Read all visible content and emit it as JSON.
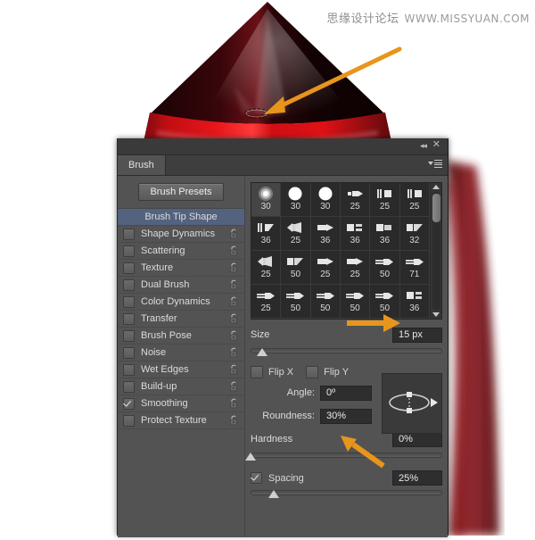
{
  "watermark": {
    "cn": "思缘设计论坛",
    "en": "WWW.MISSYUAN.COM"
  },
  "artwork": {
    "description": "red rocket nose cone with dark tip",
    "body_red": "#d60d11",
    "tip_dark": "#1b0405",
    "side_red": "#7d1a20",
    "annotation_color": "#e8951b",
    "selection_label": "elliptical marquee selection"
  },
  "panel": {
    "title_tab": "Brush",
    "collapse_icon": "collapse-icon",
    "close_icon": "close-icon",
    "menu_icon": "panel-menu-icon",
    "presets_button": "Brush Presets",
    "accent_selected": "#53627e",
    "background": "#535353"
  },
  "options": [
    {
      "label": "Brush Tip Shape",
      "type": "header",
      "checked": false,
      "lock": false
    },
    {
      "label": "Shape Dynamics",
      "type": "item",
      "checked": false,
      "lock": true
    },
    {
      "label": "Scattering",
      "type": "item",
      "checked": false,
      "lock": true
    },
    {
      "label": "Texture",
      "type": "item",
      "checked": false,
      "lock": true
    },
    {
      "label": "Dual Brush",
      "type": "item",
      "checked": false,
      "lock": true
    },
    {
      "label": "Color Dynamics",
      "type": "item",
      "checked": false,
      "lock": true
    },
    {
      "label": "Transfer",
      "type": "item",
      "checked": false,
      "lock": true
    },
    {
      "label": "Brush Pose",
      "type": "item",
      "checked": false,
      "lock": true
    },
    {
      "label": "Noise",
      "type": "item",
      "checked": false,
      "lock": true
    },
    {
      "label": "Wet Edges",
      "type": "item",
      "checked": false,
      "lock": true
    },
    {
      "label": "Build-up",
      "type": "item",
      "checked": false,
      "lock": true
    },
    {
      "label": "Smoothing",
      "type": "item",
      "checked": true,
      "lock": true
    },
    {
      "label": "Protect Texture",
      "type": "item",
      "checked": false,
      "lock": true
    }
  ],
  "brush_tips": {
    "selected_index": 0,
    "rows": [
      [
        {
          "size": "30",
          "glyph": "soft-round"
        },
        {
          "size": "30",
          "glyph": "hard-round"
        },
        {
          "size": "30",
          "glyph": "hard-round"
        },
        {
          "size": "25",
          "glyph": "flat-tip"
        },
        {
          "size": "25",
          "glyph": "bristle-flat"
        },
        {
          "size": "25",
          "glyph": "bristle-flat"
        }
      ],
      [
        {
          "size": "36",
          "glyph": "bristle-angle"
        },
        {
          "size": "25",
          "glyph": "fan"
        },
        {
          "size": "36",
          "glyph": "round-point"
        },
        {
          "size": "36",
          "glyph": "flat-square"
        },
        {
          "size": "36",
          "glyph": "flat-blunt"
        },
        {
          "size": "32",
          "glyph": "angle-flat"
        }
      ],
      [
        {
          "size": "25",
          "glyph": "fan"
        },
        {
          "size": "50",
          "glyph": "angle-flat"
        },
        {
          "size": "25",
          "glyph": "round-point"
        },
        {
          "size": "25",
          "glyph": "round-point"
        },
        {
          "size": "50",
          "glyph": "chisel"
        },
        {
          "size": "71",
          "glyph": "chisel"
        }
      ],
      [
        {
          "size": "25",
          "glyph": "chisel"
        },
        {
          "size": "50",
          "glyph": "chisel"
        },
        {
          "size": "50",
          "glyph": "chisel"
        },
        {
          "size": "50",
          "glyph": "chisel"
        },
        {
          "size": "50",
          "glyph": "chisel"
        },
        {
          "size": "36",
          "glyph": "flat-square"
        }
      ],
      [
        {
          "size": "",
          "glyph": "chisel"
        },
        {
          "size": "",
          "glyph": "chisel"
        },
        {
          "size": "",
          "glyph": "round-point"
        },
        {
          "size": "",
          "glyph": "round-point"
        },
        {
          "size": "",
          "glyph": "round-point"
        },
        {
          "size": "",
          "glyph": "round-point"
        }
      ]
    ]
  },
  "controls": {
    "size_label": "Size",
    "size_value": "15 px",
    "size_slider_pct": 6,
    "flip_x_label": "Flip X",
    "flip_y_label": "Flip Y",
    "flip_x_checked": false,
    "flip_y_checked": false,
    "angle_label": "Angle:",
    "angle_value": "0º",
    "roundness_label": "Roundness:",
    "roundness_value": "30%",
    "hardness_label": "Hardness",
    "hardness_value": "0%",
    "hardness_slider_pct": 0,
    "spacing_label": "Spacing",
    "spacing_value": "25%",
    "spacing_checked": true,
    "spacing_slider_pct": 12
  }
}
